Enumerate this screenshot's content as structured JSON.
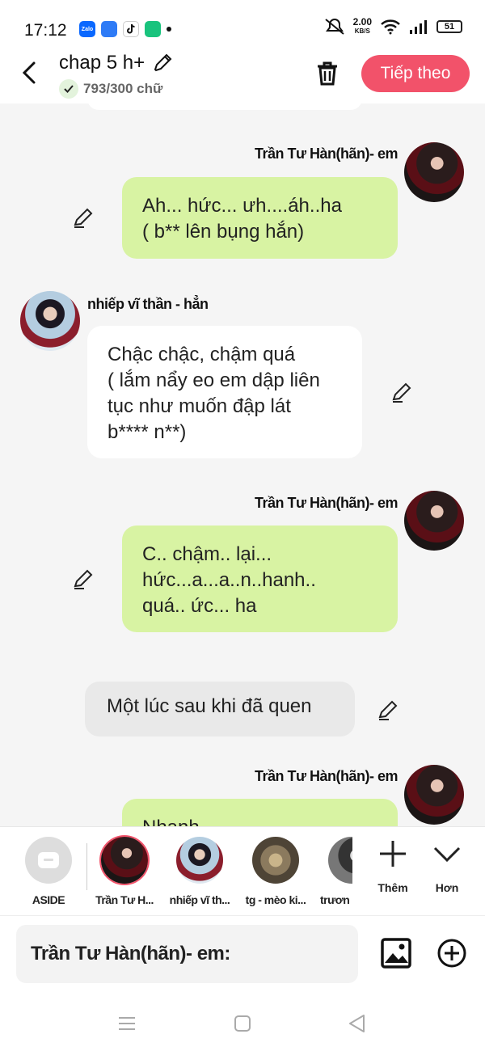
{
  "status_bar": {
    "time": "17:12",
    "apps": [
      "Zalo",
      "",
      "",
      ""
    ],
    "speed_value": "2.00",
    "speed_unit": "KB/S",
    "battery": "51"
  },
  "header": {
    "title": "chap 5 h+",
    "word_count": "793/300 chữ",
    "next_label": "Tiếp theo",
    "accent_color": "#f2526a"
  },
  "messages": [
    {
      "speaker": "Trần Tư Hàn(hãn)- em",
      "side": "right",
      "lines": [
        "Ah... hức... ưh....áh..ha",
        "( b** lên bụng hắn)"
      ]
    },
    {
      "speaker": "nhiếp vĩ thần - hẳn",
      "side": "left",
      "lines": [
        "Chậc chậc, chậm quá",
        "( lắm nẩy eo em dập liên",
        "tục như muốn đập lát",
        "b**** n**)"
      ]
    },
    {
      "speaker": "Trần Tư Hàn(hãn)- em",
      "side": "right",
      "lines": [
        "C.. chậm.. lại...",
        "hức...a...a..n..hanh..",
        "quá.. ức... ha"
      ]
    },
    {
      "speaker": "",
      "side": "aside",
      "lines": [
        "Một lúc sau khi đã quen"
      ]
    },
    {
      "speaker": "Trần Tư Hàn(hãn)- em",
      "side": "right",
      "lines": [
        "Nhanh"
      ]
    }
  ],
  "characters": [
    {
      "label": "ASIDE",
      "icon": "aside-icon"
    },
    {
      "label": "Trần Tư H...",
      "icon": "avatar"
    },
    {
      "label": "nhiếp vĩ th...",
      "icon": "avatar"
    },
    {
      "label": "tg - mèo ki...",
      "icon": "avatar"
    },
    {
      "label": "trươn",
      "icon": "avatar"
    }
  ],
  "tools": {
    "add_label": "Thêm",
    "more_label": "Hơn"
  },
  "composer": {
    "placeholder": "Trần Tư Hàn(hãn)- em:"
  },
  "colors": {
    "green_bubble": "#d8f3a3",
    "background": "#f5f5f5"
  }
}
